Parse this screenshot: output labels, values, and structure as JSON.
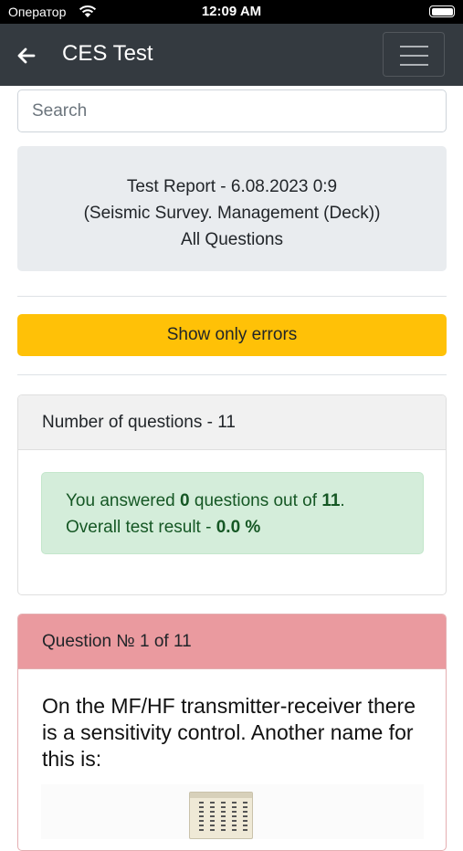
{
  "status_bar": {
    "carrier": "Оператор",
    "time": "12:09 AM"
  },
  "navbar": {
    "title": "CES Test",
    "back_icon": "arrow-left-icon",
    "menu_icon": "hamburger-icon"
  },
  "search": {
    "placeholder": "Search",
    "value": ""
  },
  "report": {
    "line1": "Test Report - 6.08.2023 0:9",
    "line2": "(Seismic Survey. Management (Deck))",
    "line3": "All Questions"
  },
  "errors_button": {
    "label": "Show only errors",
    "color": "#ffc107"
  },
  "summary": {
    "header": "Number of questions - 11",
    "text1": "You answered ",
    "answered": "0",
    "text2": " questions out of ",
    "total": "11",
    "text3": ".",
    "result_label": "Overall test result - ",
    "result_value": "0.0 %"
  },
  "question": {
    "header": "Question № 1 of 11",
    "text": "On the MF/HF transmitter-receiver there is a sensitivity control. Another name for this is:",
    "header_color": "#ea9a9f"
  }
}
